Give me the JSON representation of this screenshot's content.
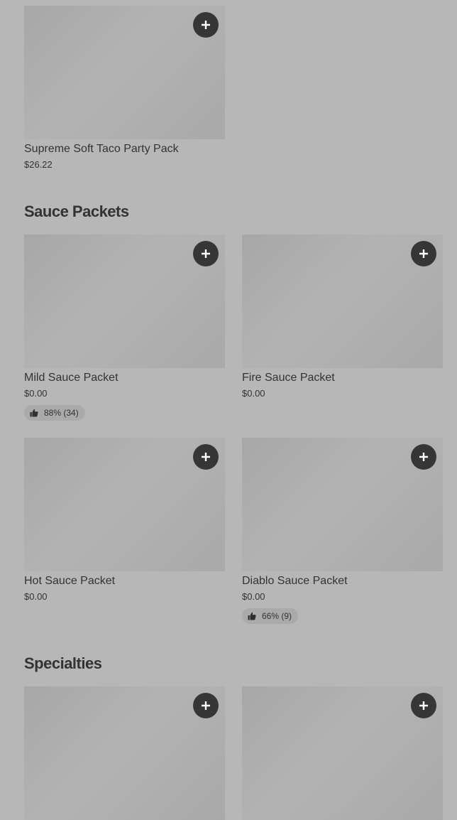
{
  "sections": [
    {
      "title": "",
      "items": [
        {
          "name": "Supreme Soft Taco Party Pack",
          "price": "$26.22"
        }
      ]
    },
    {
      "title": "Sauce Packets",
      "items": [
        {
          "name": "Mild Sauce Packet",
          "price": "$0.00",
          "rating": "88% (34)"
        },
        {
          "name": "Fire Sauce Packet",
          "price": "$0.00"
        },
        {
          "name": "Hot Sauce Packet",
          "price": "$0.00"
        },
        {
          "name": "Diablo Sauce Packet",
          "price": "$0.00",
          "rating": "66% (9)"
        }
      ]
    },
    {
      "title": "Specialties",
      "items": [
        {
          "name": "",
          "price": ""
        },
        {
          "name": "",
          "price": ""
        }
      ]
    }
  ],
  "icons": {
    "add": "plus-icon",
    "rating": "thumbs-up-icon"
  },
  "colors": {
    "background": "#b7b7b7",
    "add_button": "#363636",
    "thumb": "#a9a9a9",
    "text": "#333333"
  }
}
